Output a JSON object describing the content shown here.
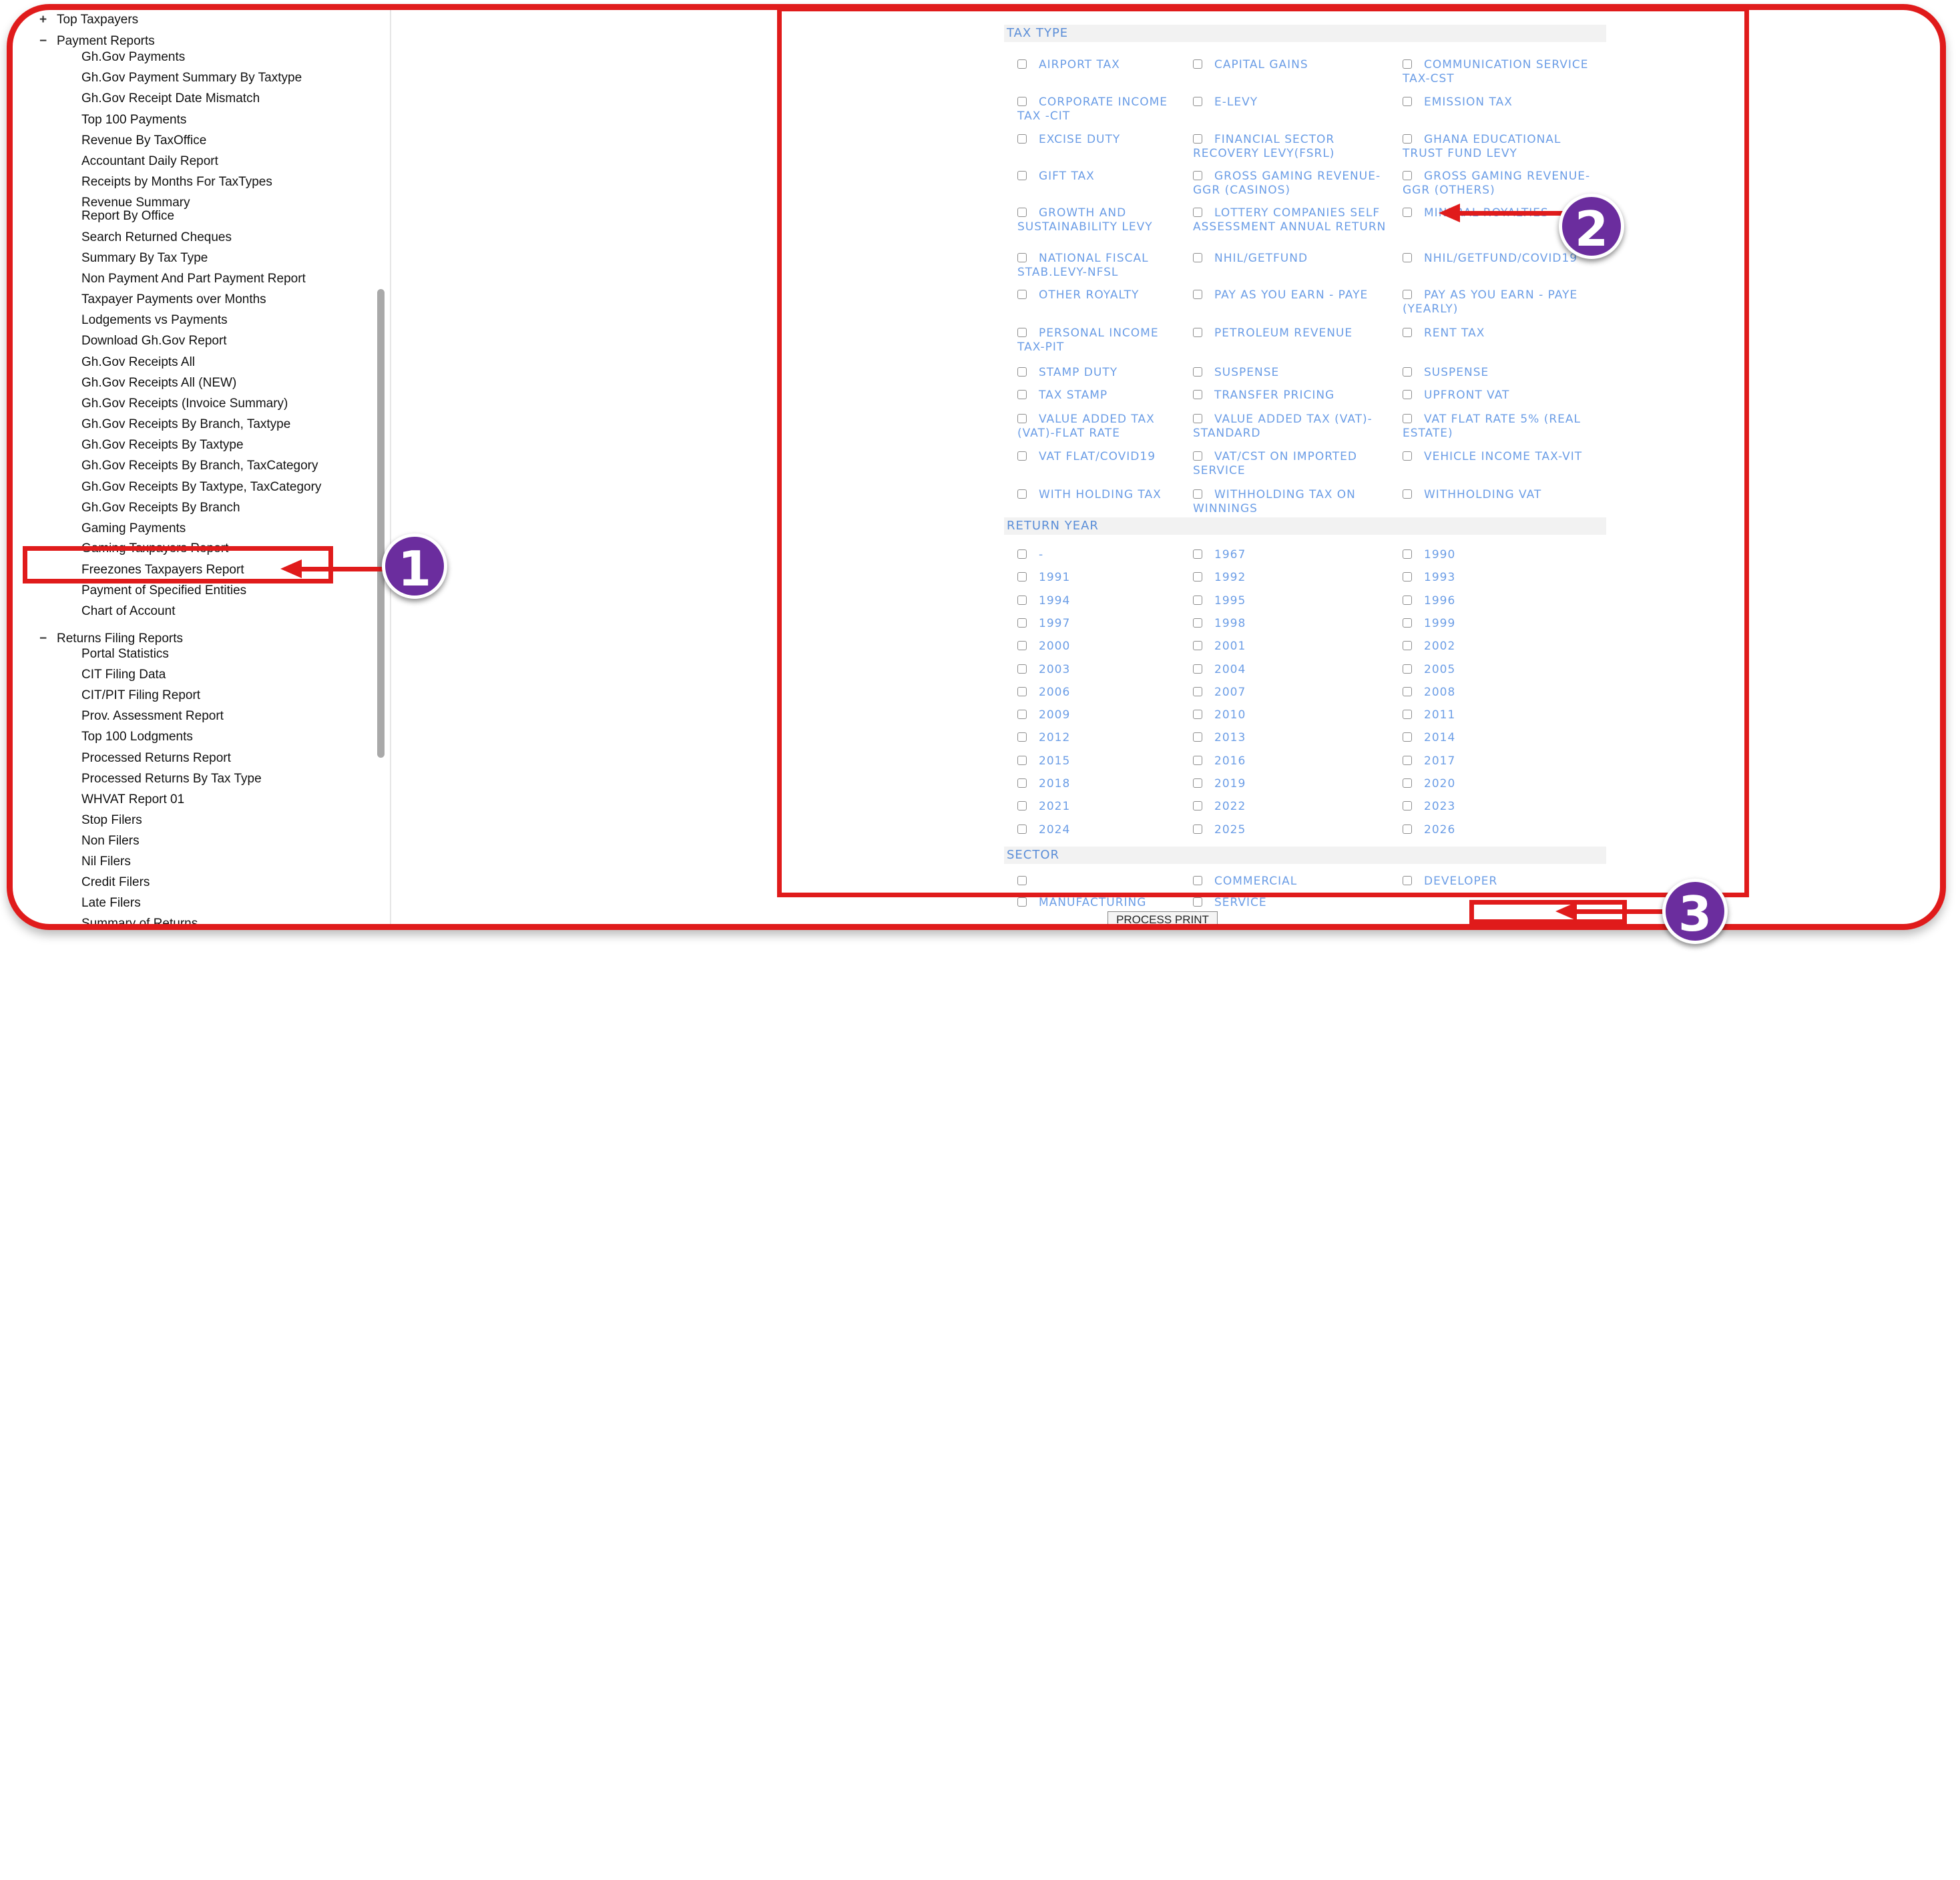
{
  "sidebar": {
    "groups": [
      {
        "toggle": "+",
        "label": "Top Taxpayers"
      },
      {
        "toggle": "−",
        "label": "Payment Reports"
      },
      {
        "toggle": "−",
        "label": "Returns Filing Reports"
      }
    ],
    "payment_items": [
      "Gh.Gov Payments",
      "Gh.Gov Payment Summary By Taxtype",
      "Gh.Gov Receipt Date Mismatch",
      "Top 100 Payments",
      "Revenue By TaxOffice",
      "Accountant Daily Report",
      "Receipts by Months For TaxTypes",
      "Revenue Summary",
      "Report By Office",
      "Search Returned Cheques",
      "Summary By Tax Type",
      "Non Payment And Part Payment Report",
      "Taxpayer Payments over Months",
      "Lodgements vs Payments",
      "Download Gh.Gov Report",
      "Gh.Gov Receipts All",
      "Gh.Gov Receipts All (NEW)",
      "Gh.Gov Receipts (Invoice Summary)",
      "Gh.Gov Receipts By Branch, Taxtype",
      "Gh.Gov Receipts By Taxtype",
      "Gh.Gov Receipts By Branch, TaxCategory",
      "Gh.Gov Receipts By Taxtype, TaxCategory",
      "Gh.Gov Receipts By Branch",
      "Gaming Payments",
      "Gaming Taxpayers Report",
      "Freezones Taxpayers Report",
      "Payment of Specified Entities",
      "Chart of Account"
    ],
    "returns_items": [
      "Portal Statistics",
      "CIT Filing Data",
      "CIT/PIT Filing Report",
      "Prov. Assessment Report",
      "Top 100 Lodgments",
      "Processed Returns Report",
      "Processed Returns By Tax Type",
      "WHVAT Report 01",
      "Stop Filers",
      "Non Filers",
      "Nil Filers",
      "Credit Filers",
      "Late Filers",
      "Summary of Returns"
    ]
  },
  "form": {
    "tax_type_header": "TAX TYPE",
    "tax_types": [
      [
        "AIRPORT TAX",
        "CAPITAL GAINS",
        "COMMUNICATION SERVICE TAX-CST"
      ],
      [
        "CORPORATE INCOME TAX -CIT",
        "E-LEVY",
        "EMISSION TAX"
      ],
      [
        "EXCISE DUTY",
        "FINANCIAL SECTOR RECOVERY LEVY(FSRL)",
        "GHANA EDUCATIONAL TRUST FUND LEVY"
      ],
      [
        "GIFT TAX",
        "GROSS GAMING REVENUE-GGR (CASINOS)",
        "GROSS GAMING REVENUE-GGR (OTHERS)"
      ],
      [
        "GROWTH AND SUSTAINABILITY LEVY",
        "LOTTERY COMPANIES SELF ASSESSMENT ANNUAL RETURN",
        "MINERAL ROYALTIES"
      ],
      [
        "NATIONAL FISCAL STAB.LEVY-NFSL",
        "NHIL/GETFUND",
        "NHIL/GETFUND/COVID19"
      ],
      [
        "OTHER ROYALTY",
        "PAY AS YOU EARN - PAYE",
        "PAY AS YOU EARN - PAYE (YEARLY)"
      ],
      [
        "PERSONAL INCOME TAX-PIT",
        "PETROLEUM REVENUE",
        "RENT TAX"
      ],
      [
        "STAMP DUTY",
        "SUSPENSE",
        "SUSPENSE"
      ],
      [
        "TAX STAMP",
        "TRANSFER PRICING",
        "UPFRONT VAT"
      ],
      [
        "VALUE ADDED TAX (VAT)-FLAT RATE",
        "VALUE ADDED TAX (VAT)-STANDARD",
        "VAT FLAT RATE 5% (REAL ESTATE)"
      ],
      [
        "VAT FLAT/COVID19",
        "VAT/CST ON IMPORTED SERVICE",
        "VEHICLE INCOME TAX-VIT"
      ],
      [
        "WITH HOLDING TAX",
        "WITHHOLDING TAX ON WINNINGS",
        "WITHHOLDING VAT"
      ]
    ],
    "return_year_header": "RETURN YEAR",
    "return_years": [
      [
        "-",
        "1967",
        "1990"
      ],
      [
        "1991",
        "1992",
        "1993"
      ],
      [
        "1994",
        "1995",
        "1996"
      ],
      [
        "1997",
        "1998",
        "1999"
      ],
      [
        "2000",
        "2001",
        "2002"
      ],
      [
        "2003",
        "2004",
        "2005"
      ],
      [
        "2006",
        "2007",
        "2008"
      ],
      [
        "2009",
        "2010",
        "2011"
      ],
      [
        "2012",
        "2013",
        "2014"
      ],
      [
        "2015",
        "2016",
        "2017"
      ],
      [
        "2018",
        "2019",
        "2020"
      ],
      [
        "2021",
        "2022",
        "2023"
      ],
      [
        "2024",
        "2025",
        "2026"
      ]
    ],
    "sector_header": "SECTOR",
    "sectors": [
      "",
      "COMMERCIAL",
      "DEVELOPER"
    ],
    "sectors_partial": [
      "MANUFACTURING",
      "SERVICE"
    ],
    "process_button": "PROCESS PRINT"
  },
  "callouts": [
    "1",
    "2",
    "3"
  ],
  "colors": {
    "highlight": "#e01b1b",
    "badge": "#6b2d9e",
    "option_text": "#6b9de6"
  }
}
